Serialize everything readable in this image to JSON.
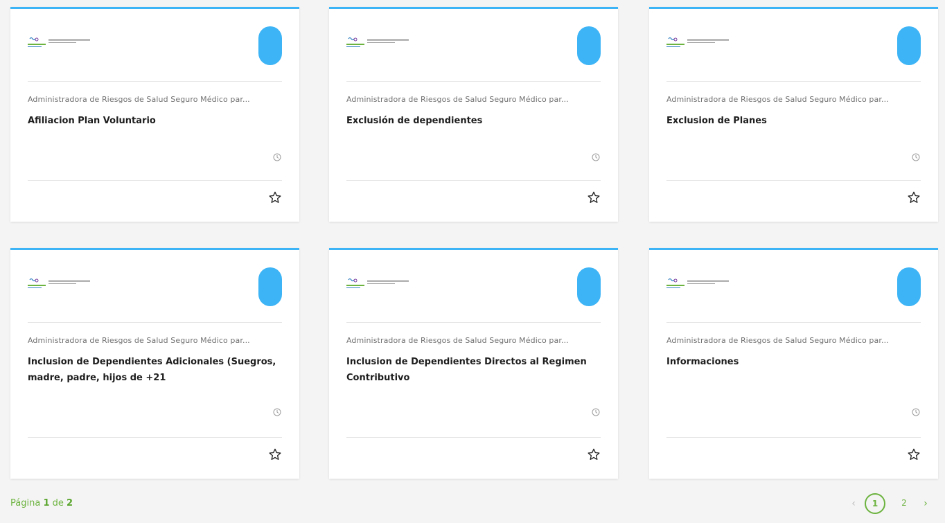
{
  "cards": [
    {
      "org": "Administradora de Riesgos de Salud Seguro Médico par...",
      "title": "Afiliacion Plan Voluntario"
    },
    {
      "org": "Administradora de Riesgos de Salud Seguro Médico par...",
      "title": "Exclusión de dependientes"
    },
    {
      "org": "Administradora de Riesgos de Salud Seguro Médico par...",
      "title": "Exclusion de Planes"
    },
    {
      "org": "Administradora de Riesgos de Salud Seguro Médico par...",
      "title": "Inclusion de Dependientes Adicionales (Suegros, madre, padre, hijos de +21"
    },
    {
      "org": "Administradora de Riesgos de Salud Seguro Médico par...",
      "title": "Inclusion de Dependientes Directos al Regimen Contributivo"
    },
    {
      "org": "Administradora de Riesgos de Salud Seguro Médico par...",
      "title": "Informaciones"
    }
  ],
  "pagination": {
    "label_prefix": "Página",
    "current": "1",
    "label_of": "de",
    "total": "2",
    "pages": [
      "1",
      "2"
    ],
    "prev_icon": "chevron-left-icon",
    "next_icon": "chevron-right-icon",
    "prev_glyph": "‹",
    "next_glyph": "›"
  },
  "colors": {
    "accent": "#3db4f5",
    "pager": "#6cb33f"
  }
}
